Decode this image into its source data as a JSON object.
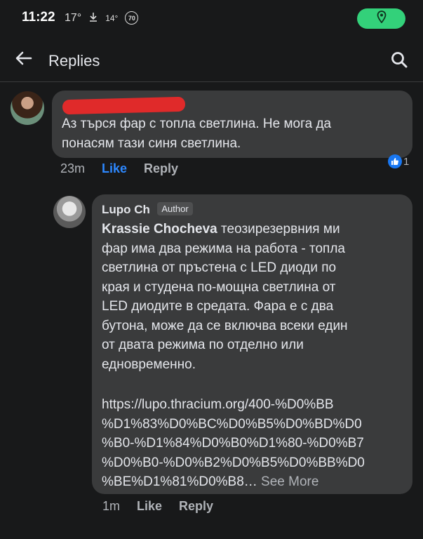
{
  "status_bar": {
    "time": "11:22",
    "temp_main": "17°",
    "temp_secondary": "14°",
    "badge": "70",
    "location_color": "#33d17a"
  },
  "app_bar": {
    "title": "Replies",
    "back_icon": "arrow-left-icon",
    "search_icon": "search-icon"
  },
  "comment": {
    "text": "Аз търся фар с топла светлина. Не мога да\nпонасям тази синя светлина.",
    "time": "23m",
    "like_label": "Like",
    "reply_label": "Reply",
    "reaction_count": "1",
    "like_color": "#2d88ff"
  },
  "reply": {
    "author": "Lupo Ch",
    "author_tag": "Author",
    "mention": "Krassie Chocheva",
    "text": " теозирезервния ми\nфар има два режима на работа - топла\nсветлина от пръстена с LED диоди по\nкрая и студена по-мощна светлина от\nLED диодите в средата. Фара е с два\nбутона, може да се включва всеки един\nот двата режима по отделно или\nедновременно.",
    "link": "https://lupo.thracium.org/400-%D0%BB\n%D1%83%D0%BC%D0%B5%D0%BD%D0\n%B0-%D1%84%D0%B0%D1%80-%D0%B7\n%D0%B0-%D0%B2%D0%B5%D0%BB%D0\n%BE%D1%81%D0%B8…",
    "see_more": " See More",
    "time": "1m",
    "like_label": "Like",
    "reply_label": "Reply"
  }
}
